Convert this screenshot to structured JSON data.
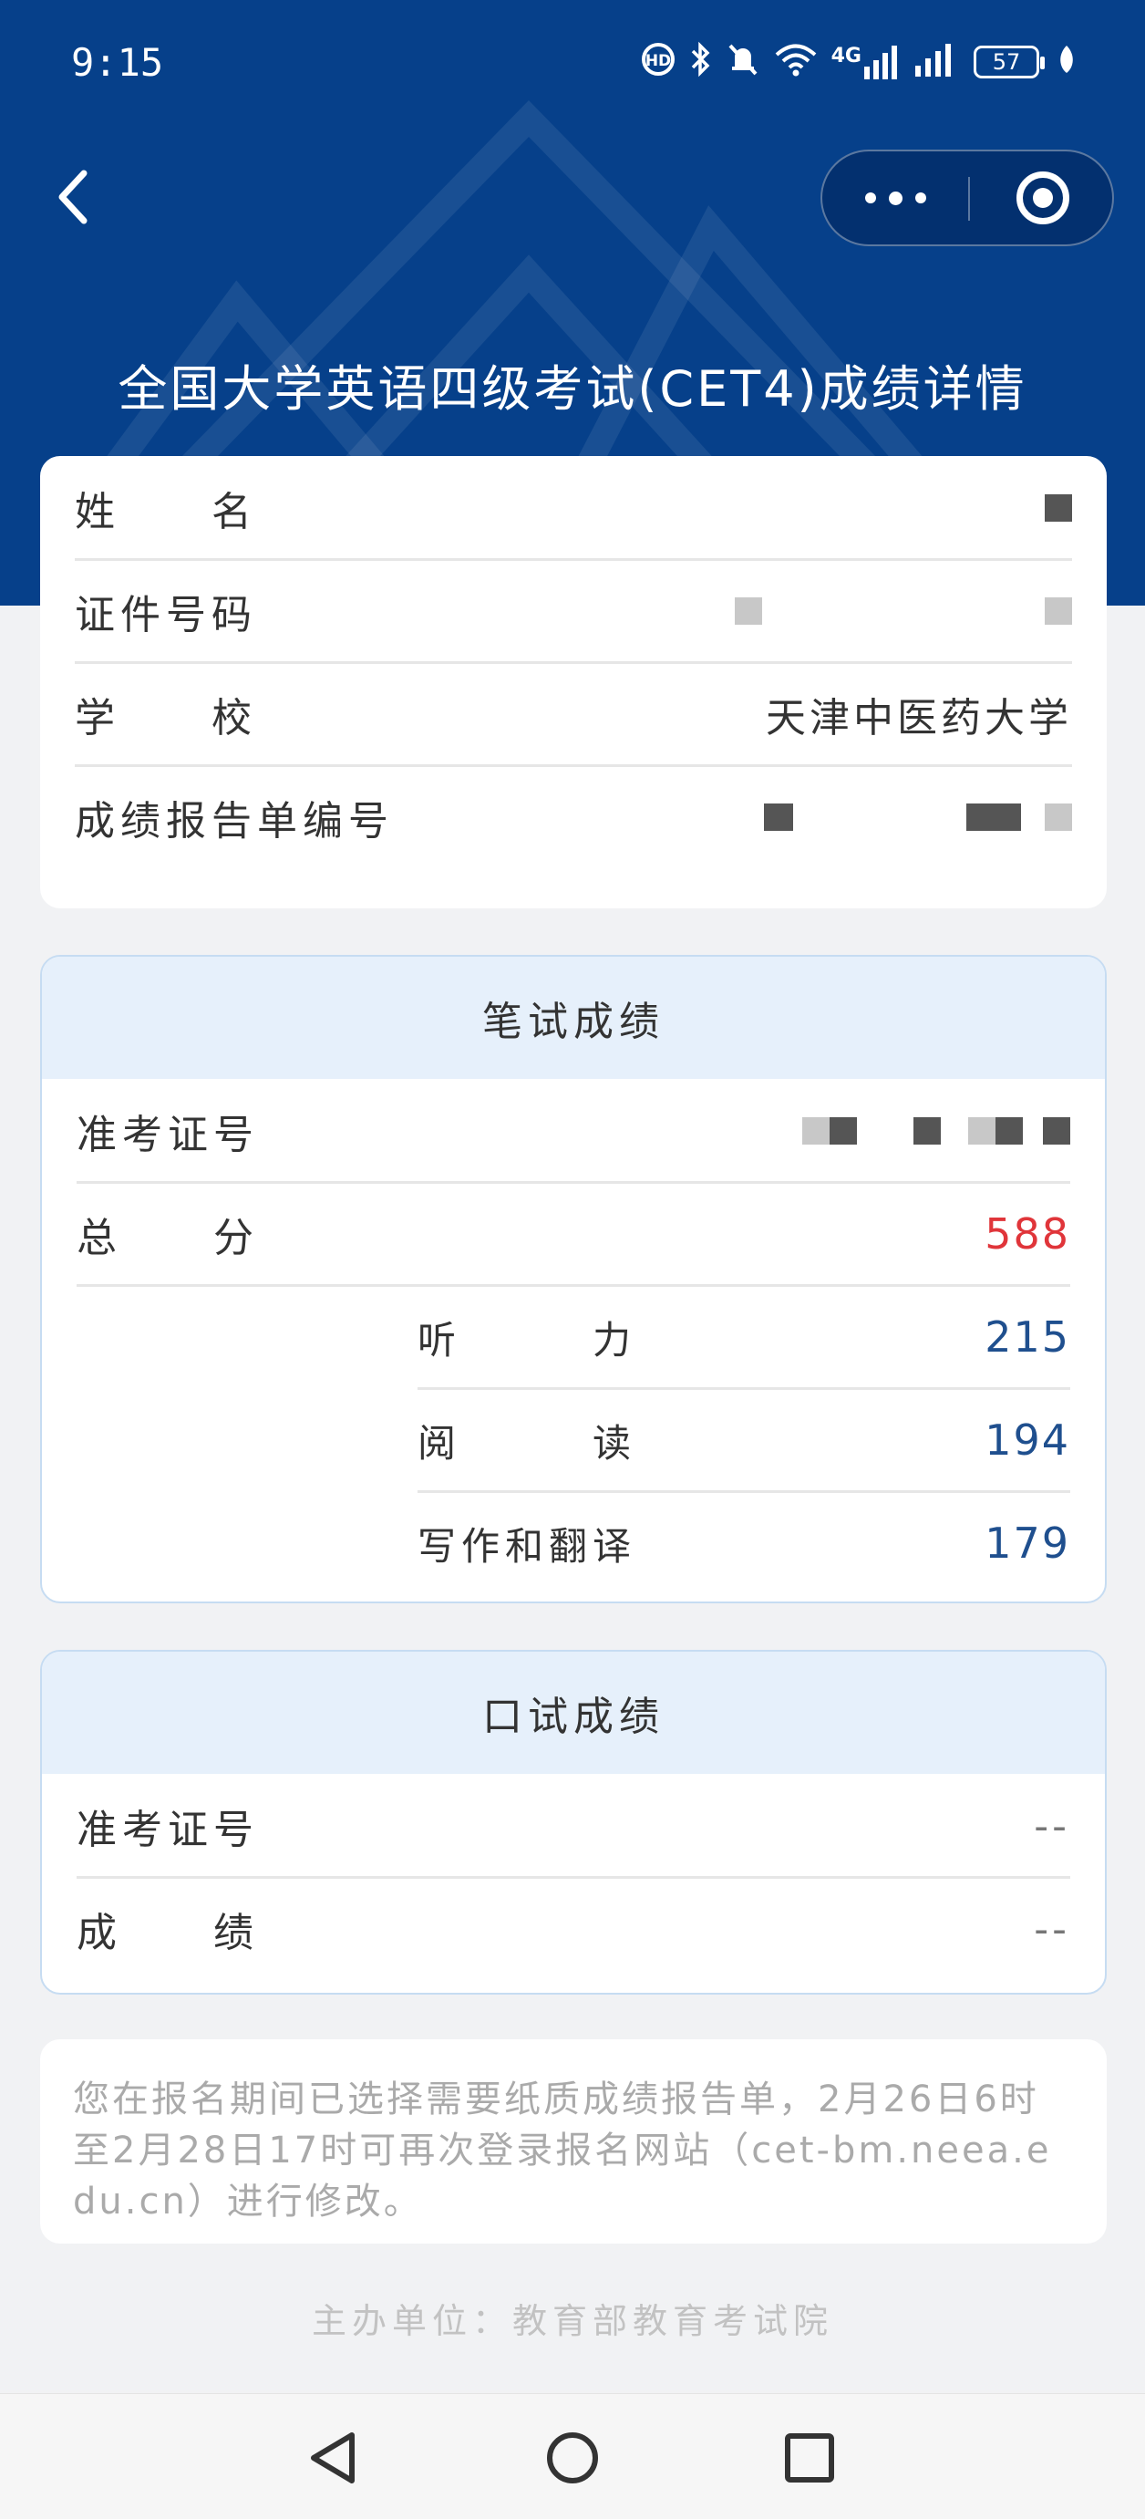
{
  "status_bar": {
    "time": "9:15",
    "network_label": "4G",
    "battery": "57",
    "icons": [
      "hd-call-icon",
      "bluetooth-icon",
      "mute-icon",
      "wifi-icon",
      "signal-4g-icon",
      "signal-icon",
      "battery-icon",
      "leaf-icon"
    ]
  },
  "header": {
    "back_icon": "chevron-left-icon",
    "more_icon": "more-dots-icon",
    "close_icon": "target-circle-icon",
    "title": "全国大学英语四级考试(CET4)成绩详情",
    "background_color": "#06408a"
  },
  "personal_info": {
    "rows": [
      {
        "label": "姓　　名",
        "value": ""
      },
      {
        "label": "证件号码",
        "value": ""
      },
      {
        "label": "学　　校",
        "value": "天津中医药大学"
      },
      {
        "label": "成绩报告单编号",
        "value": ""
      }
    ]
  },
  "written": {
    "heading": "笔试成绩",
    "ticket_label": "准考证号",
    "total_label": "总　　分",
    "total_value": "588",
    "subscores": [
      {
        "label": "听　　　力",
        "value": "215"
      },
      {
        "label": "阅　　　读",
        "value": "194"
      },
      {
        "label": "写作和翻译",
        "value": "179"
      }
    ],
    "total_color": "#e0353a",
    "sub_color": "#1f4f8e"
  },
  "oral": {
    "heading": "口试成绩",
    "ticket_label": "准考证号",
    "ticket_value": "--",
    "score_label": "成　　绩",
    "score_value": "--"
  },
  "notice": "您在报名期间已选择需要纸质成绩报告单，2月26日6时至2月28日17时可再次登录报名网站（cet-bm.neea.edu.cn）进行修改。",
  "footer": "主办单位：教育部教育考试院",
  "nav": {
    "icons": [
      "back-triangle-icon",
      "home-circle-icon",
      "recents-square-icon"
    ]
  }
}
